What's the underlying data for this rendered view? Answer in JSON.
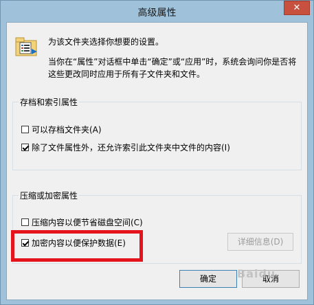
{
  "window": {
    "title": "高级属性",
    "close_label": "✕"
  },
  "intro": {
    "line1": "为该文件夹选择你想要的设置。",
    "line2": "当你在“属性”对话框中单击“确定”或“应用”时，系统会询问你是否将这些更改同时应用于所有子文件夹和文件。"
  },
  "archive_group": {
    "title": "存档和索引属性",
    "archive_checkbox": {
      "label": "可以存档文件夹(A)",
      "checked": false
    },
    "index_checkbox": {
      "label": "除了文件属性外，还允许索引此文件夹中文件的内容(I)",
      "checked": true
    }
  },
  "compress_group": {
    "title": "压缩或加密属性",
    "compress_checkbox": {
      "label": "压缩内容以便节省磁盘空间(C)",
      "checked": false
    },
    "encrypt_checkbox": {
      "label": "加密内容以便保护数据(E)",
      "checked": true
    },
    "details_button": "详细信息(D)"
  },
  "buttons": {
    "ok": "确定",
    "cancel": "取消"
  },
  "watermark": "Baidu"
}
